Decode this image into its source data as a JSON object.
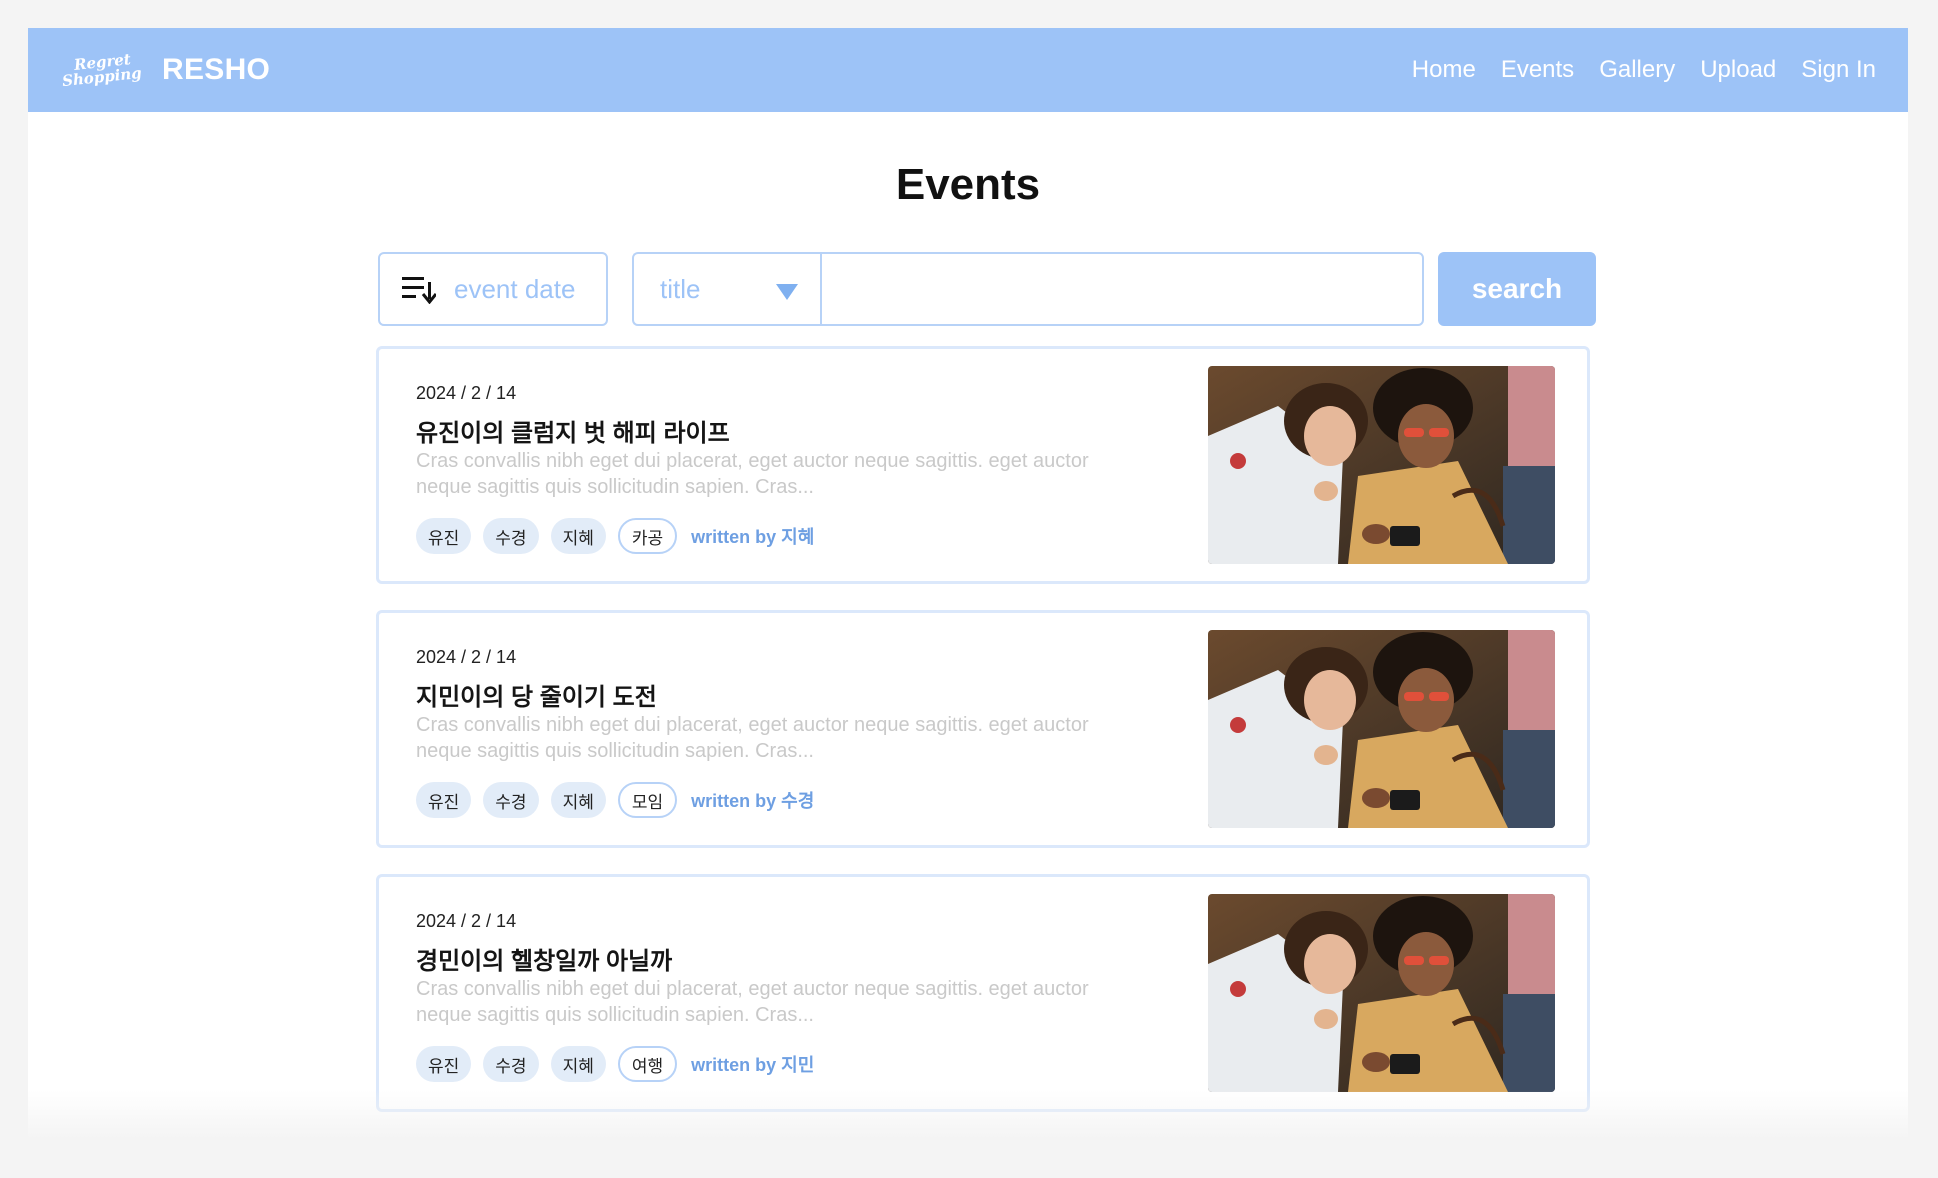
{
  "navbar": {
    "logo_line1": "Regret",
    "logo_line2": "Shopping",
    "brand": "RESHO",
    "links": [
      "Home",
      "Events",
      "Gallery",
      "Upload",
      "Sign In"
    ]
  },
  "page_title": "Events",
  "toolbar": {
    "sort_label": "event date",
    "field_selected": "title",
    "search_value": "",
    "search_label": "search"
  },
  "events": [
    {
      "date": "2024 / 2 / 14",
      "title": "유진이의 클럼지 벗 해피 라이프",
      "description": "Cras convallis nibh eget dui placerat, eget auctor neque sagittis. eget auctor neque sagittis quis sollicitudin sapien. Cras...",
      "members": [
        "유진",
        "수경",
        "지혜"
      ],
      "category": "카공",
      "author": "written by 지혜"
    },
    {
      "date": "2024 / 2 / 14",
      "title": "지민이의 당 줄이기 도전",
      "description": "Cras convallis nibh eget dui placerat, eget auctor neque sagittis. eget auctor neque sagittis quis sollicitudin sapien. Cras...",
      "members": [
        "유진",
        "수경",
        "지혜"
      ],
      "category": "모임",
      "author": "written by 수경"
    },
    {
      "date": "2024 / 2 / 14",
      "title": "경민이의 헬창일까 아닐까",
      "description": "Cras convallis nibh eget dui placerat, eget auctor neque sagittis. eget auctor neque sagittis quis sollicitudin sapien. Cras...",
      "members": [
        "유진",
        "수경",
        "지혜"
      ],
      "category": "여행",
      "author": "written by 지민"
    }
  ],
  "colors": {
    "accent": "#9dc3f7",
    "border": "#b7d2f7",
    "tag_bg": "#e2ecf8",
    "author": "#6e9fe2"
  }
}
